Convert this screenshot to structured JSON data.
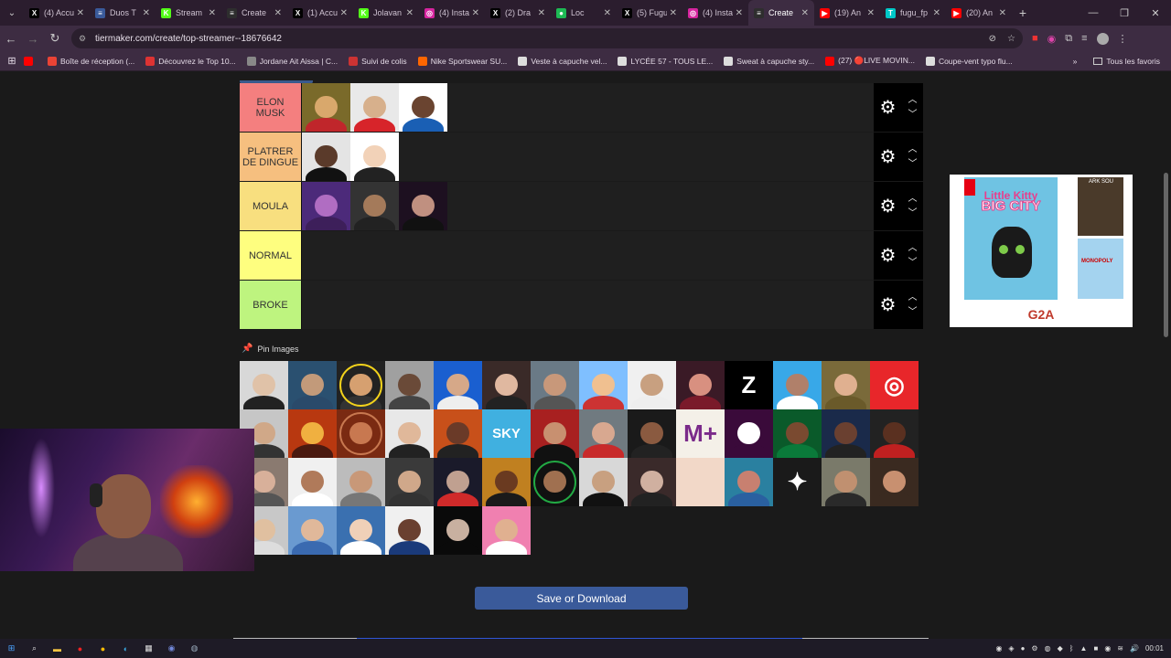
{
  "browser": {
    "tabs": [
      {
        "title": "(4) Accu",
        "icon": "x-icon",
        "color": "#000000",
        "glyph": "X"
      },
      {
        "title": "Duos T",
        "icon": "duos-icon",
        "color": "#3a5a9a",
        "glyph": "≡"
      },
      {
        "title": "Stream",
        "icon": "kick-icon",
        "color": "#53fc18",
        "glyph": "K"
      },
      {
        "title": "Create",
        "icon": "tiermaker-icon",
        "color": "#2e2e2e",
        "glyph": "≡"
      },
      {
        "title": "(1) Accu",
        "icon": "x-icon",
        "color": "#000000",
        "glyph": "X"
      },
      {
        "title": "Jolavan",
        "icon": "kick-icon",
        "color": "#53fc18",
        "glyph": "K"
      },
      {
        "title": "(4) Insta",
        "icon": "instagram-icon",
        "color": "#d6249f",
        "glyph": "◎"
      },
      {
        "title": "(2) Dra",
        "icon": "x-icon",
        "color": "#000000",
        "glyph": "X"
      },
      {
        "title": "Loc",
        "icon": "spotify-icon",
        "color": "#1db954",
        "glyph": "●"
      },
      {
        "title": "(5) Fugu",
        "icon": "x-icon",
        "color": "#000000",
        "glyph": "X"
      },
      {
        "title": "(4) Insta",
        "icon": "instagram-icon",
        "color": "#d6249f",
        "glyph": "◎"
      },
      {
        "title": "Create",
        "icon": "tiermaker-icon",
        "color": "#2e2e2e",
        "glyph": "≡",
        "active": true
      },
      {
        "title": "(19) An",
        "icon": "youtube-icon",
        "color": "#ff0000",
        "glyph": "▶"
      },
      {
        "title": "fugu_fp",
        "icon": "tiktok-icon",
        "color": "#00c8c8",
        "glyph": "T"
      },
      {
        "title": "(20) An",
        "icon": "youtube-icon",
        "color": "#ff0000",
        "glyph": "▶"
      }
    ],
    "url": "tiermaker.com/create/top-streamer--18676642",
    "bookmarks": [
      {
        "label": "",
        "color": "#ff0000"
      },
      {
        "label": "Boîte de réception (...",
        "color": "#ea4335"
      },
      {
        "label": "Découvrez le Top 10...",
        "color": "#d33"
      },
      {
        "label": "Jordane Ait Aissa | C...",
        "color": "#888"
      },
      {
        "label": "Suivi de colis",
        "color": "#c33"
      },
      {
        "label": "Nike Sportswear SU...",
        "color": "#f60"
      },
      {
        "label": "Veste à capuche vel...",
        "color": "#ddd"
      },
      {
        "label": "LYCÉE 57 - TOUS LE...",
        "color": "#ddd"
      },
      {
        "label": "Sweat à capuche sty...",
        "color": "#ddd"
      },
      {
        "label": "(27) 🔴LIVE MOVIN...",
        "color": "#f00"
      },
      {
        "label": "Coupe-vent typo flu...",
        "color": "#ddd"
      }
    ],
    "all_bookmarks_label": "Tous les favoris"
  },
  "tiers": [
    {
      "label": "ELON MUSK",
      "color": "#f47f7f",
      "items": [
        {
          "bg": "#7a6a2a",
          "skin": "#d9a86c",
          "shirt": "#c0262b"
        },
        {
          "bg": "#e9e9e9",
          "skin": "#d7b08c",
          "shirt": "#d7242a"
        },
        {
          "bg": "#ffffff",
          "skin": "#6a4430",
          "shirt": "#1a5fb4"
        }
      ]
    },
    {
      "label": "PLATRER DE DINGUE",
      "color": "#f6bf7f",
      "items": [
        {
          "bg": "#e4e4e4",
          "skin": "#5a3a2a",
          "shirt": "#111111"
        },
        {
          "bg": "#ffffff",
          "skin": "#f2d2b8",
          "shirt": "#222222"
        }
      ]
    },
    {
      "label": "MOULA",
      "color": "#f8df7f",
      "items": [
        {
          "bg": "#4c2a7a",
          "skin": "#b06dc2",
          "shirt": "#3d1f5a"
        },
        {
          "bg": "#333333",
          "skin": "#a47a5a",
          "shirt": "#222222"
        },
        {
          "bg": "#1d1020",
          "skin": "#c09080",
          "shirt": "#111111"
        }
      ]
    },
    {
      "label": "NORMAL",
      "color": "#fefe7f",
      "items": []
    },
    {
      "label": "BROKE",
      "color": "#bef47f",
      "items": []
    }
  ],
  "pin_label": "Pin Images",
  "pool": [
    {
      "bg": "#d8d8d8",
      "skin": "#e0c2a8",
      "shirt": "#222"
    },
    {
      "bg": "#2a5070",
      "skin": "#c29a7a",
      "shirt": "#2a4a6a"
    },
    {
      "bg": "#222222",
      "skin": "#d6a070",
      "shirt": "#333",
      "ring": "#f2d21b"
    },
    {
      "bg": "#a0a0a0",
      "skin": "#6a4a38",
      "shirt": "#444"
    },
    {
      "bg": "#1a5fd0",
      "skin": "#d6a888",
      "shirt": "#eee"
    },
    {
      "bg": "#3a2a28",
      "skin": "#e0b8a0",
      "shirt": "#222"
    },
    {
      "bg": "#6a7a86",
      "skin": "#c8987a",
      "shirt": "#555"
    },
    {
      "bg": "#7fbfff",
      "skin": "#f0c090",
      "shirt": "#c33"
    },
    {
      "bg": "#f0f0f0",
      "skin": "#c8a080",
      "shirt": "#eee"
    },
    {
      "bg": "#3a1a26",
      "skin": "#d89080",
      "shirt": "#7a1a2a"
    },
    {
      "bg": "#000000",
      "skin": "#ffffff",
      "shirt": "#000",
      "logo": "Z"
    },
    {
      "bg": "#38a8e8",
      "skin": "#b0806a",
      "shirt": "#fff"
    },
    {
      "bg": "#7a6a3a",
      "skin": "#e0b090",
      "shirt": "#6a5a2a"
    },
    {
      "bg": "#e8262a",
      "skin": "#ffffff",
      "shirt": "#e8262a",
      "logo": "◎"
    },
    {
      "bg": "#c6c6c6",
      "skin": "#d0a888",
      "shirt": "#333"
    },
    {
      "bg": "#b83810",
      "skin": "#f0b040",
      "shirt": "#4a1a10"
    },
    {
      "bg": "#7a2a12",
      "skin": "#c87850",
      "shirt": "#7a2a12",
      "ring": "#c87850"
    },
    {
      "bg": "#e8e8e8",
      "skin": "#e0b89a",
      "shirt": "#222"
    },
    {
      "bg": "#c8501a",
      "skin": "#6a3a28",
      "shirt": "#222"
    },
    {
      "bg": "#40b0e0",
      "skin": "#ffffff",
      "shirt": "#40b0e0",
      "logo": "SKY"
    },
    {
      "bg": "#a82020",
      "skin": "#c89070",
      "shirt": "#111"
    },
    {
      "bg": "#707a80",
      "skin": "#d8a890",
      "shirt": "#c82a2a"
    },
    {
      "bg": "#1a1a1a",
      "skin": "#8a5a40",
      "shirt": "#222"
    },
    {
      "bg": "#f4f0e8",
      "skin": "#7a2a8a",
      "shirt": "#f4f0e8",
      "logo": "M+"
    },
    {
      "bg": "#3a0a3a",
      "skin": "#ffffff",
      "shirt": "#3a0a3a"
    },
    {
      "bg": "#0a5a2a",
      "skin": "#7a4a30",
      "shirt": "#0a7a3a"
    },
    {
      "bg": "#1a2a4a",
      "skin": "#6a4030",
      "shirt": "#222"
    },
    {
      "bg": "#222222",
      "skin": "#5a3020",
      "shirt": "#c02020"
    },
    {
      "bg": "#8a7a70",
      "skin": "#d8b09a",
      "shirt": "#555"
    },
    {
      "bg": "#f0f0f0",
      "skin": "#b07a5a",
      "shirt": "#fff"
    },
    {
      "bg": "#bcbcbc",
      "skin": "#c89878",
      "shirt": "#777"
    },
    {
      "bg": "#3a3a3a",
      "skin": "#d0a88a",
      "shirt": "#333"
    },
    {
      "bg": "#1a1a2a",
      "skin": "#c0a090",
      "shirt": "#d02a2a"
    },
    {
      "bg": "#c08020",
      "skin": "#6a3a20",
      "shirt": "#1a1a1a"
    },
    {
      "bg": "#111111",
      "skin": "#a07050",
      "shirt": "#111",
      "ring": "#22aa44"
    },
    {
      "bg": "#d8d8d8",
      "skin": "#c8a080",
      "shirt": "#111"
    },
    {
      "bg": "#3a2a2a",
      "skin": "#d0b0a0",
      "shirt": "#222"
    },
    {
      "bg": "#f2d8c8",
      "skin": "#f2d8c8",
      "shirt": "#f2d8c8"
    },
    {
      "bg": "#2a80a0",
      "skin": "#c88070",
      "shirt": "#2a60a0"
    },
    {
      "bg": "#1a1a1a",
      "skin": "#ffffff",
      "shirt": "#1a1a1a",
      "logo": "✦"
    },
    {
      "bg": "#7a7a6a",
      "skin": "#c09070",
      "shirt": "#2a2a2a"
    },
    {
      "bg": "#3a2a20",
      "skin": "#c89070",
      "shirt": "#3a2a20"
    },
    {
      "bg": "#c8c8c8",
      "skin": "#e0c0a0",
      "shirt": "#ddd"
    },
    {
      "bg": "#6a9ad0",
      "skin": "#e0b89a",
      "shirt": "#3a6ab0"
    },
    {
      "bg": "#3a70b0",
      "skin": "#f0d0b8",
      "shirt": "#ffffff"
    },
    {
      "bg": "#f0f0f0",
      "skin": "#6a4030",
      "shirt": "#1a3a7a"
    },
    {
      "bg": "#0a0a0a",
      "skin": "#c8b0a0",
      "shirt": "#0a0a0a"
    },
    {
      "bg": "#f080b0",
      "skin": "#e0b090",
      "shirt": "#fff"
    }
  ],
  "save_label": "Save or Download",
  "ad": {
    "title_line1": "Little Kitty",
    "title_line2": "BIG CITY",
    "brand": "G2A",
    "mini1": "ARK SOU",
    "mini2": "MONOPOLY"
  },
  "taskbar": {
    "time": "00:01"
  }
}
